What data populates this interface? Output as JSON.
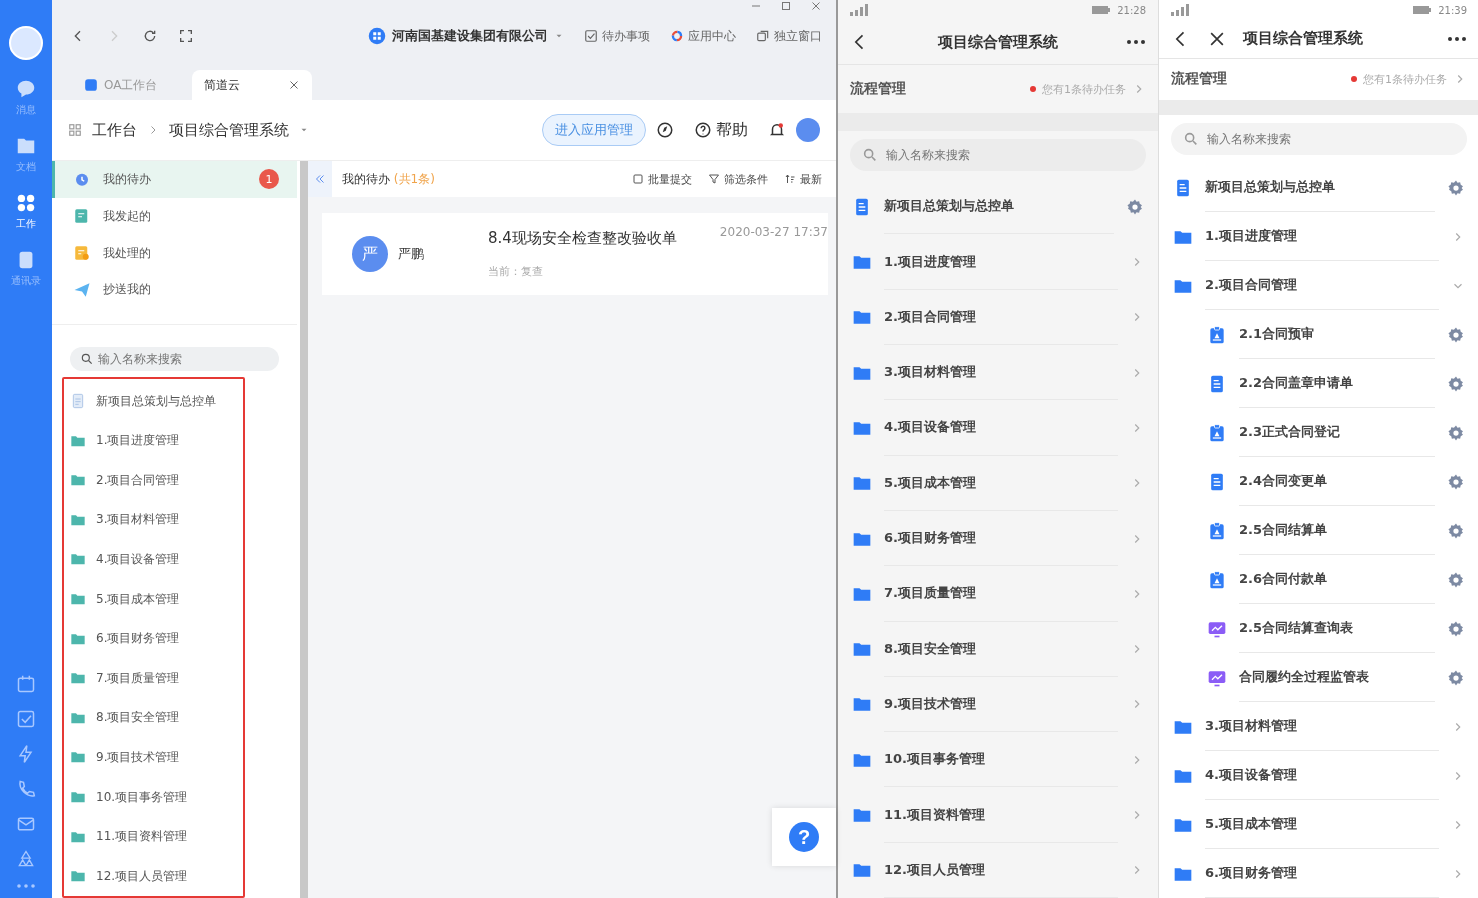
{
  "desktop": {
    "rail": {
      "items": [
        {
          "label": "消息",
          "kind": "chat",
          "selected": false
        },
        {
          "label": "文档",
          "kind": "docs",
          "selected": false
        },
        {
          "label": "工作",
          "kind": "apps",
          "selected": true
        },
        {
          "label": "通讯录",
          "kind": "contacts",
          "selected": false
        }
      ],
      "tools": [
        {
          "kind": "calendar"
        },
        {
          "kind": "check"
        },
        {
          "kind": "bolt"
        },
        {
          "kind": "phone"
        },
        {
          "kind": "mail"
        },
        {
          "kind": "recycle"
        },
        {
          "kind": "more"
        }
      ]
    },
    "toolbar": {
      "company": "河南国基建设集团有限公司",
      "links": [
        {
          "label": "待办事项",
          "kind": "todo"
        },
        {
          "label": "应用中心",
          "kind": "apps"
        },
        {
          "label": "独立窗口",
          "kind": "window"
        }
      ]
    },
    "tabs": [
      {
        "label": "OA工作台",
        "selected": false
      },
      {
        "label": "简道云",
        "selected": true
      }
    ],
    "breadcrumb": [
      "工作台",
      "项目综合管理系统"
    ],
    "manage_button": "进入应用管理",
    "help": "帮助",
    "nav": [
      {
        "label": "我的待办",
        "kind": "clock",
        "selected": true,
        "badge": "1"
      },
      {
        "label": "我发起的",
        "kind": "edit",
        "selected": false
      },
      {
        "label": "我处理的",
        "kind": "done",
        "selected": false
      },
      {
        "label": "抄送我的",
        "kind": "send",
        "selected": false
      }
    ],
    "search": {
      "placeholder": "输入名称来搜索"
    },
    "forms": [
      {
        "label": "新项目总策划与总控单",
        "kind": "doc"
      },
      {
        "label": "1.项目进度管理",
        "kind": "folder"
      },
      {
        "label": "2.项目合同管理",
        "kind": "folder"
      },
      {
        "label": "3.项目材料管理",
        "kind": "folder"
      },
      {
        "label": "4.项目设备管理",
        "kind": "folder"
      },
      {
        "label": "5.项目成本管理",
        "kind": "folder"
      },
      {
        "label": "6.项目财务管理",
        "kind": "folder"
      },
      {
        "label": "7.项目质量管理",
        "kind": "folder"
      },
      {
        "label": "8.项目安全管理",
        "kind": "folder"
      },
      {
        "label": "9.项目技术管理",
        "kind": "folder"
      },
      {
        "label": "10.项目事务管理",
        "kind": "folder"
      },
      {
        "label": "11.项目资料管理",
        "kind": "folder"
      },
      {
        "label": "12.项目人员管理",
        "kind": "folder"
      }
    ],
    "inbox": {
      "title": "我的待办",
      "count": "(共1条)",
      "actions": [
        {
          "label": "批量提交",
          "kind": "submit"
        },
        {
          "label": "筛选条件",
          "kind": "filter"
        },
        {
          "label": "最新",
          "kind": "sort"
        }
      ],
      "tasks": [
        {
          "avatar": "严",
          "name": "严鹏",
          "title": "8.4现场安全检查整改验收单",
          "time": "2020-03-27 17:37",
          "status": "当前：复查"
        }
      ]
    },
    "help_button": "?"
  },
  "phone_a": {
    "status_time": "21:28",
    "title": "项目综合管理系统",
    "section": {
      "title": "流程管理",
      "notice": "您有1条待办任务"
    },
    "search": {
      "placeholder": "输入名称来搜索"
    },
    "items": [
      {
        "label": "新项目总策划与总控单",
        "kind": "doc"
      },
      {
        "label": "1.项目进度管理",
        "kind": "folder"
      },
      {
        "label": "2.项目合同管理",
        "kind": "folder"
      },
      {
        "label": "3.项目材料管理",
        "kind": "folder"
      },
      {
        "label": "4.项目设备管理",
        "kind": "folder"
      },
      {
        "label": "5.项目成本管理",
        "kind": "folder"
      },
      {
        "label": "6.项目财务管理",
        "kind": "folder"
      },
      {
        "label": "7.项目质量管理",
        "kind": "folder"
      },
      {
        "label": "8.项目安全管理",
        "kind": "folder"
      },
      {
        "label": "9.项目技术管理",
        "kind": "folder"
      },
      {
        "label": "10.项目事务管理",
        "kind": "folder"
      },
      {
        "label": "11.项目资料管理",
        "kind": "folder"
      },
      {
        "label": "12.项目人员管理",
        "kind": "folder"
      }
    ]
  },
  "phone_b": {
    "status_time": "21:39",
    "title": "项目综合管理系统",
    "section": {
      "title": "流程管理",
      "notice": "您有1条待办任务"
    },
    "search": {
      "placeholder": "输入名称来搜索"
    },
    "items": [
      {
        "label": "新项目总策划与总控单",
        "kind": "doc"
      },
      {
        "label": "1.项目进度管理",
        "kind": "folder",
        "expanded": false
      },
      {
        "label": "2.项目合同管理",
        "kind": "folder",
        "expanded": true,
        "children": [
          {
            "label": "2.1合同预审",
            "kind": "clipboard"
          },
          {
            "label": "2.2合同盖章申请单",
            "kind": "doc"
          },
          {
            "label": "2.3正式合同登记",
            "kind": "clipboard"
          },
          {
            "label": "2.4合同变更单",
            "kind": "doc"
          },
          {
            "label": "2.5合同结算单",
            "kind": "clipboard"
          },
          {
            "label": "2.6合同付款单",
            "kind": "clipboard"
          },
          {
            "label": "2.5合同结算查询表",
            "kind": "chart"
          },
          {
            "label": "合同履约全过程监管表",
            "kind": "chart"
          }
        ]
      },
      {
        "label": "3.项目材料管理",
        "kind": "folder",
        "expanded": false
      },
      {
        "label": "4.项目设备管理",
        "kind": "folder",
        "expanded": false
      },
      {
        "label": "5.项目成本管理",
        "kind": "folder",
        "expanded": false
      },
      {
        "label": "6.项目财务管理",
        "kind": "folder",
        "expanded": false
      }
    ]
  }
}
